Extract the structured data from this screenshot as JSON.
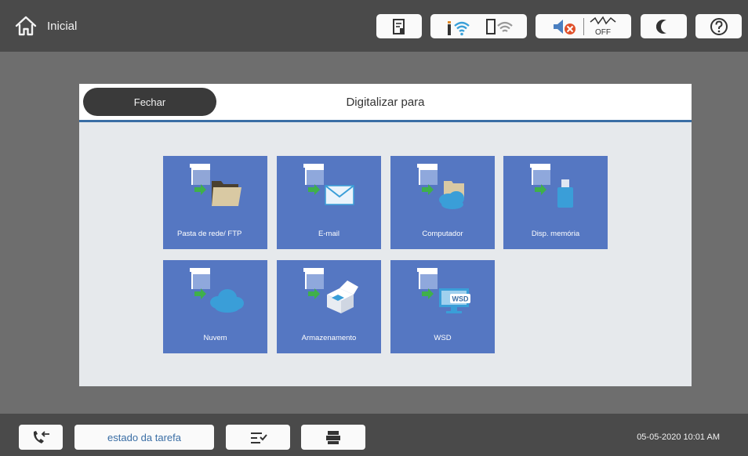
{
  "header": {
    "home_label": "Inicial",
    "status_icons": [
      "job-info-icon",
      "wifi-icon",
      "wifi-direct-icon",
      "mute-icon",
      "fax-off-icon",
      "sleep-icon",
      "help-icon"
    ],
    "fax_off_text": "OFF"
  },
  "dialog": {
    "close_label": "Fechar",
    "title": "Digitalizar para",
    "tiles": [
      {
        "label": "Pasta de rede/ FTP",
        "icon": "network-folder-icon"
      },
      {
        "label": "E-mail",
        "icon": "email-icon"
      },
      {
        "label": "Computador",
        "icon": "computer-icon"
      },
      {
        "label": "Disp. memória",
        "icon": "memory-device-icon"
      },
      {
        "label": "Nuvem",
        "icon": "cloud-icon"
      },
      {
        "label": "Armazenamento",
        "icon": "storage-icon"
      },
      {
        "label": "WSD",
        "icon": "wsd-icon"
      }
    ],
    "wsd_badge": "WSD"
  },
  "footer": {
    "job_status_label": "estado da tarefa",
    "datetime": "05-05-2020 10:01 AM"
  },
  "colors": {
    "tile": "#5577c2",
    "accent": "#3a6ea5",
    "background": "#6e6e6e",
    "bar": "#4a4a4a"
  }
}
